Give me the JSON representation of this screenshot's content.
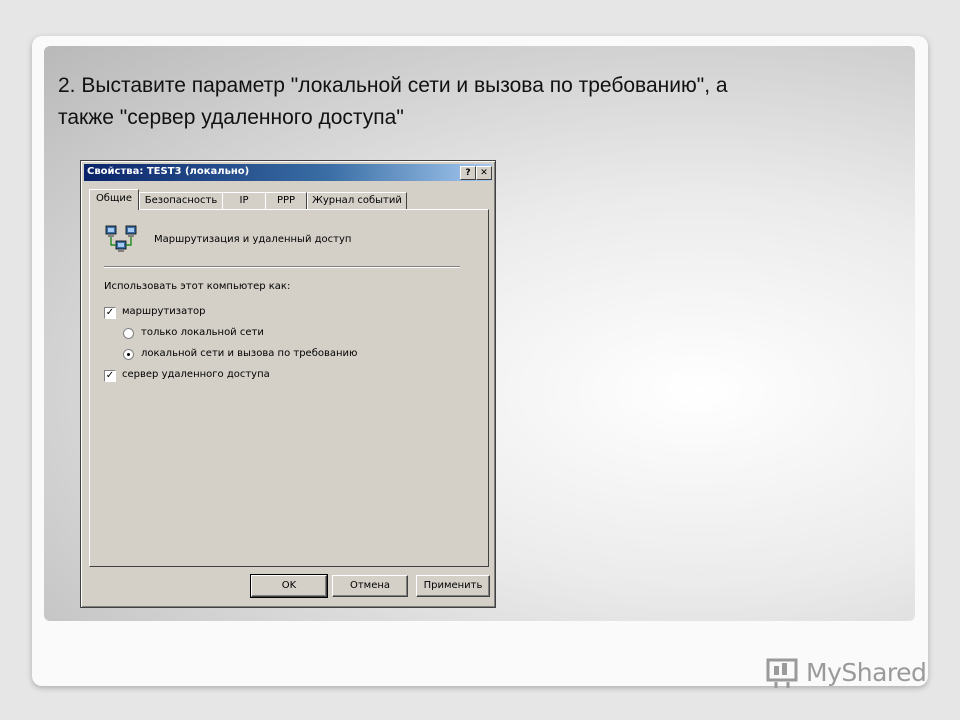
{
  "slide": {
    "title_line1": "2. Выставите параметр \"локальной сети и вызова по требованию\", а",
    "title_line2": "также \"сервер удаленного доступа\""
  },
  "dialog": {
    "title": "Свойства: TEST3 (локально)",
    "help_button": "?",
    "close_button": "✕",
    "tabs": [
      {
        "label": "Общие",
        "active": true
      },
      {
        "label": "Безопасность",
        "active": false
      },
      {
        "label": "IP",
        "active": false
      },
      {
        "label": "PPP",
        "active": false
      },
      {
        "label": "Журнал событий",
        "active": false
      }
    ],
    "panel": {
      "heading": "Маршрутизация и удаленный доступ",
      "icon": "network-computers-icon",
      "use_as_label": "Использовать этот компьютер как:",
      "router_checkbox": {
        "label": "маршрутизатор",
        "checked": true
      },
      "radio_lan_only": {
        "label": "только локальной сети",
        "selected": false
      },
      "radio_lan_dial": {
        "label": "локальной сети и вызова по требованию",
        "selected": true
      },
      "remote_access_checkbox": {
        "label": "сервер удаленного доступа",
        "checked": true
      }
    },
    "buttons": {
      "ok": "OK",
      "cancel": "Отмена",
      "apply": "Применить"
    }
  },
  "logo": {
    "text": "MyShared",
    "icon": "myshared-logo-icon"
  }
}
